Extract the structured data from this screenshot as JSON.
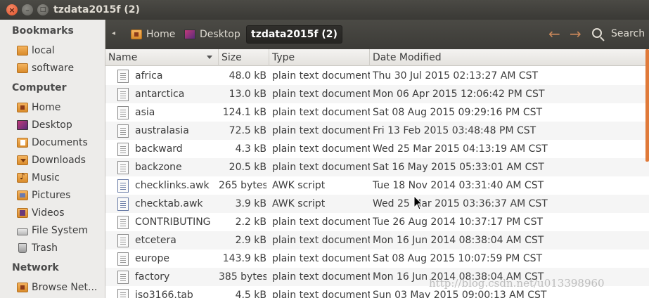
{
  "window": {
    "title": "tzdata2015f (2)"
  },
  "sidebar": {
    "sections": [
      {
        "heading": "Bookmarks",
        "items": [
          {
            "label": "local",
            "icon": "folder-icon"
          },
          {
            "label": "software",
            "icon": "folder-icon"
          }
        ]
      },
      {
        "heading": "Computer",
        "items": [
          {
            "label": "Home",
            "icon": "home-folder-icon"
          },
          {
            "label": "Desktop",
            "icon": "desktop-icon"
          },
          {
            "label": "Documents",
            "icon": "documents-folder-icon"
          },
          {
            "label": "Downloads",
            "icon": "downloads-folder-icon"
          },
          {
            "label": "Music",
            "icon": "music-folder-icon"
          },
          {
            "label": "Pictures",
            "icon": "pictures-folder-icon"
          },
          {
            "label": "Videos",
            "icon": "videos-folder-icon"
          },
          {
            "label": "File System",
            "icon": "drive-icon"
          },
          {
            "label": "Trash",
            "icon": "trash-icon"
          }
        ]
      },
      {
        "heading": "Network",
        "items": [
          {
            "label": "Browse Net...",
            "icon": "network-folder-icon"
          }
        ]
      }
    ]
  },
  "toolbar": {
    "breadcrumbs": [
      {
        "label": "Home",
        "icon": "home-folder-icon"
      },
      {
        "label": "Desktop",
        "icon": "desktop-icon"
      },
      {
        "label": "tzdata2015f (2)",
        "active": true
      }
    ],
    "search_label": "Search"
  },
  "columns": {
    "name": "Name",
    "size": "Size",
    "type": "Type",
    "modified": "Date Modified"
  },
  "files": [
    {
      "name": "africa",
      "size": "48.0 kB",
      "type": "plain text document",
      "modified": "Thu 30 Jul 2015 02:13:27 AM CST",
      "icon": "text-file-icon"
    },
    {
      "name": "antarctica",
      "size": "13.0 kB",
      "type": "plain text document",
      "modified": "Mon 06 Apr 2015 12:06:42 PM CST",
      "icon": "text-file-icon"
    },
    {
      "name": "asia",
      "size": "124.1 kB",
      "type": "plain text document",
      "modified": "Sat 08 Aug 2015 09:29:16 PM CST",
      "icon": "text-file-icon"
    },
    {
      "name": "australasia",
      "size": "72.5 kB",
      "type": "plain text document",
      "modified": "Fri 13 Feb 2015 03:48:48 PM CST",
      "icon": "text-file-icon"
    },
    {
      "name": "backward",
      "size": "4.3 kB",
      "type": "plain text document",
      "modified": "Wed 25 Mar 2015 04:13:19 AM CST",
      "icon": "text-file-icon"
    },
    {
      "name": "backzone",
      "size": "20.5 kB",
      "type": "plain text document",
      "modified": "Sat 16 May 2015 05:33:01 AM CST",
      "icon": "text-file-icon"
    },
    {
      "name": "checklinks.awk",
      "size": "265 bytes",
      "type": "AWK script",
      "modified": "Tue 18 Nov 2014 03:31:40 AM CST",
      "icon": "script-file-icon"
    },
    {
      "name": "checktab.awk",
      "size": "3.9 kB",
      "type": "AWK script",
      "modified": "Wed 25 Mar 2015 03:36:37 AM CST",
      "icon": "script-file-icon"
    },
    {
      "name": "CONTRIBUTING",
      "size": "2.2 kB",
      "type": "plain text document",
      "modified": "Tue 26 Aug 2014 10:37:17 PM CST",
      "icon": "text-file-icon"
    },
    {
      "name": "etcetera",
      "size": "2.9 kB",
      "type": "plain text document",
      "modified": "Mon 16 Jun 2014 08:38:04 AM CST",
      "icon": "text-file-icon"
    },
    {
      "name": "europe",
      "size": "143.9 kB",
      "type": "plain text document",
      "modified": "Sat 08 Aug 2015 10:07:59 PM CST",
      "icon": "text-file-icon"
    },
    {
      "name": "factory",
      "size": "385 bytes",
      "type": "plain text document",
      "modified": "Mon 16 Jun 2014 08:38:04 AM CST",
      "icon": "text-file-icon"
    },
    {
      "name": "iso3166.tab",
      "size": "4.5 kB",
      "type": "plain text document",
      "modified": "Sun 03 May 2015 09:00:13 AM CST",
      "icon": "text-file-icon"
    }
  ],
  "watermark": "http://blog.csdn.net/u013398960",
  "colors": {
    "accent": "#e07a3a",
    "titlebar": "#3c3b37",
    "sidebar": "#edecea"
  }
}
